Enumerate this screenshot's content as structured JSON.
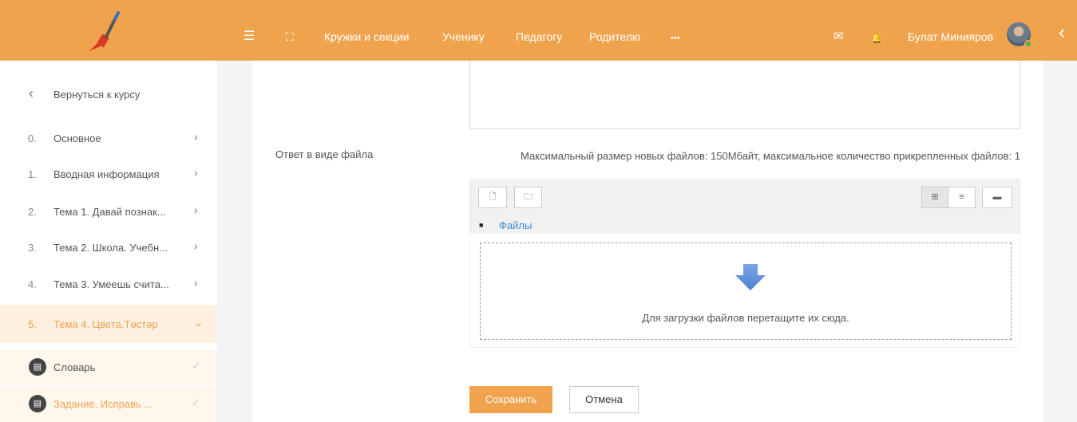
{
  "colors": {
    "accent": "#f0a34d",
    "link": "#3b8ad8"
  },
  "topbar": {
    "menu_icon": "☰",
    "fullscreen_icon": "⛶",
    "nav": [
      "Кружки и секции",
      "Ученику",
      "Педагогу",
      "Родителю"
    ],
    "more_label": "•••",
    "mail_icon": "✉",
    "bell_icon": "🔔",
    "user_name": "Булат Минияров",
    "collapse_icon": "‹"
  },
  "sidebar": {
    "back_label": "Вернуться к курсу",
    "back_icon": "‹",
    "sections": [
      {
        "num": "0.",
        "label": "Основное",
        "chev": "›"
      },
      {
        "num": "1.",
        "label": "Вводная информация",
        "chev": "›"
      },
      {
        "num": "2.",
        "label": "Тема 1. Давай познак...",
        "chev": "›"
      },
      {
        "num": "3.",
        "label": "Тема 2. Школа. Учебн...",
        "chev": "›"
      },
      {
        "num": "4.",
        "label": "Тема 3. Умеешь счита...",
        "chev": "›"
      },
      {
        "num": "5.",
        "label": "Тема 4. Цвета.Төстәр",
        "chev": "⌄"
      }
    ],
    "activities": [
      {
        "label": "Словарь",
        "check": "✓"
      },
      {
        "label": "Задание. Исправь ...",
        "check": "✓"
      }
    ]
  },
  "form": {
    "file_label": "Ответ в виде файла",
    "max_info": "Максимальный размер новых файлов: 150Мбайт, максимальное количество прикрепленных файлов: 1",
    "breadcrumb": "Файлы",
    "drop_text": "Для загрузки файлов перетащите их сюда.",
    "save_label": "Сохранить",
    "cancel_label": "Отмена"
  }
}
